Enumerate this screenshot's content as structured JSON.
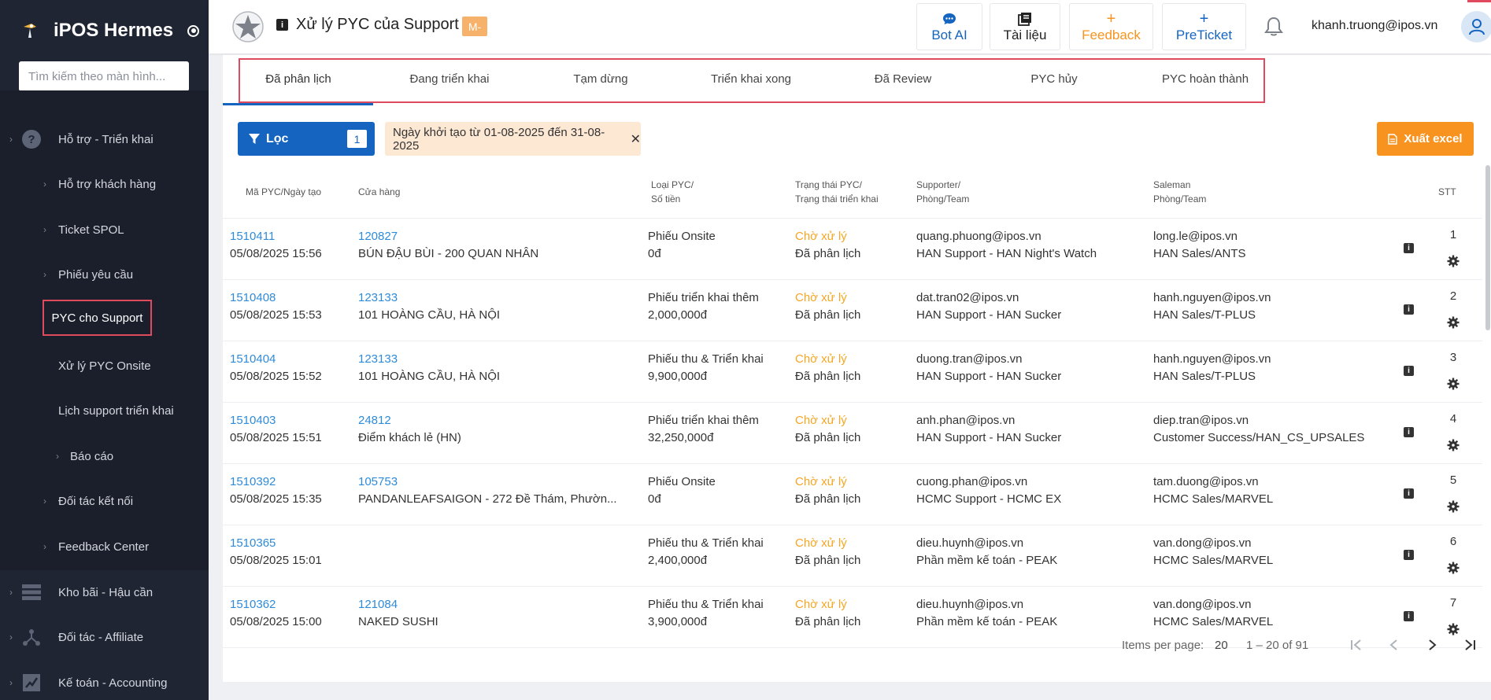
{
  "app": {
    "name": "iPOS Hermes"
  },
  "sidebar": {
    "search_placeholder": "Tìm kiếm theo màn hình...",
    "items": [
      {
        "label": "Hỗ trợ - Triển khai",
        "icon": "question-circle-icon"
      },
      {
        "label": "Hỗ trợ khách hàng"
      },
      {
        "label": "Ticket SPOL"
      },
      {
        "label": "Phiếu yêu cầu"
      },
      {
        "label": "PYC cho Support",
        "active": true
      },
      {
        "label": "Xử lý PYC Onsite"
      },
      {
        "label": "Lịch support triển khai"
      },
      {
        "label": "Báo cáo"
      },
      {
        "label": "Đối tác kết nối"
      },
      {
        "label": "Feedback Center"
      },
      {
        "label": "Kho bãi - Hậu cần",
        "icon": "server-icon"
      },
      {
        "label": "Đối tác - Affiliate",
        "icon": "network-icon"
      },
      {
        "label": "Kế toán - Accounting",
        "icon": "chart-square-icon"
      }
    ]
  },
  "header": {
    "title": "Xử lý PYC của Support",
    "badge": "M-",
    "buttons": {
      "bot_ai": "Bot AI",
      "tai_lieu": "Tài liệu",
      "feedback": "Feedback",
      "preticket": "PreTicket"
    },
    "user_email": "khanh.truong@ipos.vn"
  },
  "tabs": [
    "Đã phân lịch",
    "Đang triển khai",
    "Tạm dừng",
    "Triển khai xong",
    "Đã Review",
    "PYC hủy",
    "PYC hoàn thành"
  ],
  "filter": {
    "label": "Lọc",
    "count": "1",
    "chip": "Ngày khởi tạo từ 01-08-2025 đến 31-08-2025",
    "excel": "Xuất excel"
  },
  "table": {
    "headers": {
      "code": [
        "Mã PYC/Ngày tạo"
      ],
      "store": [
        "Cửa hàng"
      ],
      "type": [
        "Loại PYC/",
        "Số tiền"
      ],
      "status": [
        "Trạng thái PYC/",
        "Trạng thái triển khai"
      ],
      "supporter": [
        "Supporter/",
        "Phòng/Team"
      ],
      "saleman": [
        "Saleman",
        "Phòng/Team"
      ],
      "stt": [
        "STT"
      ]
    },
    "rows": [
      {
        "code": "1510411",
        "date": "05/08/2025 15:56",
        "store_id": "120827",
        "store_name": "BÚN ĐẬU BÙI - 200 QUAN NHÂN",
        "type": "Phiếu Onsite",
        "amount": "0đ",
        "status": "Chờ xử lý",
        "deploy": "Đã phân lịch",
        "supporter": "quang.phuong@ipos.vn",
        "sup_team": "HAN Support - HAN Night's Watch",
        "saleman": "long.le@ipos.vn",
        "sale_team": "HAN Sales/ANTS",
        "stt": "1"
      },
      {
        "code": "1510408",
        "date": "05/08/2025 15:53",
        "store_id": "123133",
        "store_name": "101 HOÀNG CẦU, HÀ NỘI",
        "type": "Phiếu triển khai thêm",
        "amount": "2,000,000đ",
        "status": "Chờ xử lý",
        "deploy": "Đã phân lịch",
        "supporter": "dat.tran02@ipos.vn",
        "sup_team": "HAN Support - HAN Sucker",
        "saleman": "hanh.nguyen@ipos.vn",
        "sale_team": "HAN Sales/T-PLUS",
        "stt": "2"
      },
      {
        "code": "1510404",
        "date": "05/08/2025 15:52",
        "store_id": "123133",
        "store_name": "101 HOÀNG CẦU, HÀ NỘI",
        "type": "Phiếu thu & Triển khai",
        "amount": "9,900,000đ",
        "status": "Chờ xử lý",
        "deploy": "Đã phân lịch",
        "supporter": "duong.tran@ipos.vn",
        "sup_team": "HAN Support - HAN Sucker",
        "saleman": "hanh.nguyen@ipos.vn",
        "sale_team": "HAN Sales/T-PLUS",
        "stt": "3"
      },
      {
        "code": "1510403",
        "date": "05/08/2025 15:51",
        "store_id": "24812",
        "store_name": "Điểm khách lẻ (HN)",
        "type": "Phiếu triển khai thêm",
        "amount": "32,250,000đ",
        "status": "Chờ xử lý",
        "deploy": "Đã phân lịch",
        "supporter": "anh.phan@ipos.vn",
        "sup_team": "HAN Support - HAN Sucker",
        "saleman": "diep.tran@ipos.vn",
        "sale_team": "Customer Success/HAN_CS_UPSALES",
        "stt": "4"
      },
      {
        "code": "1510392",
        "date": "05/08/2025 15:35",
        "store_id": "105753",
        "store_name": "PANDANLEAFSAIGON - 272 Đề Thám, Phườn...",
        "type": "Phiếu Onsite",
        "amount": "0đ",
        "status": "Chờ xử lý",
        "deploy": "Đã phân lịch",
        "supporter": "cuong.phan@ipos.vn",
        "sup_team": "HCMC Support - HCMC EX",
        "saleman": "tam.duong@ipos.vn",
        "sale_team": "HCMC Sales/MARVEL",
        "stt": "5"
      },
      {
        "code": "1510365",
        "date": "05/08/2025 15:01",
        "store_id": "",
        "store_name": "",
        "type": "Phiếu thu & Triển khai",
        "amount": "2,400,000đ",
        "status": "Chờ xử lý",
        "deploy": "Đã phân lịch",
        "supporter": "dieu.huynh@ipos.vn",
        "sup_team": "Phần mềm kế toán - PEAK",
        "saleman": "van.dong@ipos.vn",
        "sale_team": "HCMC Sales/MARVEL",
        "stt": "6"
      },
      {
        "code": "1510362",
        "date": "05/08/2025 15:00",
        "store_id": "121084",
        "store_name": "NAKED SUSHI",
        "type": "Phiếu thu & Triển khai",
        "amount": "3,900,000đ",
        "status": "Chờ xử lý",
        "deploy": "Đã phân lịch",
        "supporter": "dieu.huynh@ipos.vn",
        "sup_team": "Phần mềm kế toán - PEAK",
        "saleman": "van.dong@ipos.vn",
        "sale_team": "HCMC Sales/MARVEL",
        "stt": "7"
      }
    ]
  },
  "pager": {
    "items_per_page_label": "Items per page:",
    "items_per_page": "20",
    "range": "1 – 20 of 91"
  },
  "colors": {
    "sidebar_bg": "#1f2533",
    "primary": "#1565c0",
    "link": "#2f8bd8",
    "status_pending": "#f5a623",
    "feedback": "#f7931e",
    "highlight_border": "#e04a5f"
  }
}
